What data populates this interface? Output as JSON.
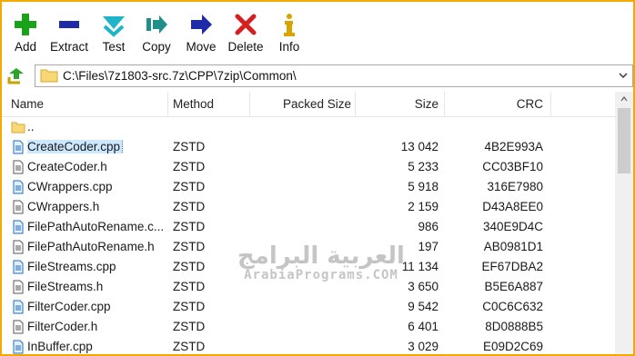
{
  "toolbar": {
    "add": "Add",
    "extract": "Extract",
    "test": "Test",
    "copy": "Copy",
    "move": "Move",
    "delete": "Delete",
    "info": "Info"
  },
  "address": {
    "path": "C:\\Files\\7z1803-src.7z\\CPP\\7zip\\Common\\"
  },
  "columns": {
    "name": "Name",
    "method": "Method",
    "packed_size": "Packed Size",
    "size": "Size",
    "crc": "CRC"
  },
  "files": [
    {
      "name": "..",
      "type": "folder",
      "method": "",
      "packed": "",
      "size": "",
      "crc": ""
    },
    {
      "name": "CreateCoder.cpp",
      "type": "cpp",
      "method": "ZSTD",
      "packed": "",
      "size": "13 042",
      "crc": "4B2E993A",
      "selected": true
    },
    {
      "name": "CreateCoder.h",
      "type": "h",
      "method": "ZSTD",
      "packed": "",
      "size": "5 233",
      "crc": "CC03BF10"
    },
    {
      "name": "CWrappers.cpp",
      "type": "cpp",
      "method": "ZSTD",
      "packed": "",
      "size": "5 918",
      "crc": "316E7980"
    },
    {
      "name": "CWrappers.h",
      "type": "h",
      "method": "ZSTD",
      "packed": "",
      "size": "2 159",
      "crc": "D43A8EE0"
    },
    {
      "name": "FilePathAutoRename.c...",
      "type": "cpp",
      "method": "ZSTD",
      "packed": "",
      "size": "986",
      "crc": "340E9D4C"
    },
    {
      "name": "FilePathAutoRename.h",
      "type": "h",
      "method": "ZSTD",
      "packed": "",
      "size": "197",
      "crc": "AB0981D1"
    },
    {
      "name": "FileStreams.cpp",
      "type": "cpp",
      "method": "ZSTD",
      "packed": "",
      "size": "11 134",
      "crc": "EF67DBA2"
    },
    {
      "name": "FileStreams.h",
      "type": "h",
      "method": "ZSTD",
      "packed": "",
      "size": "3 650",
      "crc": "B5E6A887"
    },
    {
      "name": "FilterCoder.cpp",
      "type": "cpp",
      "method": "ZSTD",
      "packed": "",
      "size": "9 542",
      "crc": "C0C6C632"
    },
    {
      "name": "FilterCoder.h",
      "type": "h",
      "method": "ZSTD",
      "packed": "",
      "size": "6 401",
      "crc": "8D0888B5"
    },
    {
      "name": "InBuffer.cpp",
      "type": "cpp",
      "method": "ZSTD",
      "packed": "",
      "size": "3 029",
      "crc": "E09D2C69"
    }
  ],
  "watermark": {
    "arabic": "العربية البرامج",
    "latin": "ArabiaPrograms.COM"
  },
  "colors": {
    "frame": "#f2a900",
    "add_icon": "#1aa31a",
    "extract_icon": "#1f2aa8",
    "test_icon": "#20b4c8",
    "copy_icon": "#1f8f8a",
    "move_icon": "#1f2aa8",
    "delete_icon": "#d81f1f",
    "info_icon": "#d9a300",
    "selection": "#cce8ff"
  }
}
